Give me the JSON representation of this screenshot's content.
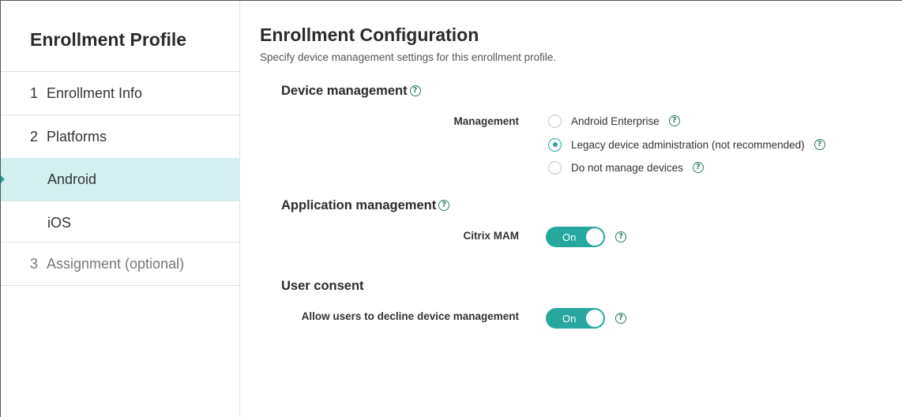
{
  "sidebar": {
    "title": "Enrollment Profile",
    "items": [
      {
        "num": "1",
        "label": "Enrollment Info"
      },
      {
        "num": "2",
        "label": "Platforms"
      },
      {
        "label": "Android",
        "active": true
      },
      {
        "label": "iOS"
      },
      {
        "num": "3",
        "label": "Assignment (optional)"
      }
    ]
  },
  "main": {
    "title": "Enrollment Configuration",
    "subtitle": "Specify device management settings for this enrollment profile.",
    "device_management": {
      "title": "Device management",
      "field_label": "Management",
      "options": [
        {
          "label": "Android Enterprise",
          "checked": false
        },
        {
          "label": "Legacy device administration (not recommended)",
          "checked": true
        },
        {
          "label": "Do not manage devices",
          "checked": false
        }
      ]
    },
    "application_management": {
      "title": "Application management",
      "field_label": "Citrix MAM",
      "toggle_label": "On"
    },
    "user_consent": {
      "title": "User consent",
      "field_label": "Allow users to decline device management",
      "toggle_label": "On"
    }
  },
  "colors": {
    "accent": "#27a89e",
    "active_row": "#d3eff0",
    "help_icon": "#2e7d5b"
  },
  "help_glyph": "?"
}
